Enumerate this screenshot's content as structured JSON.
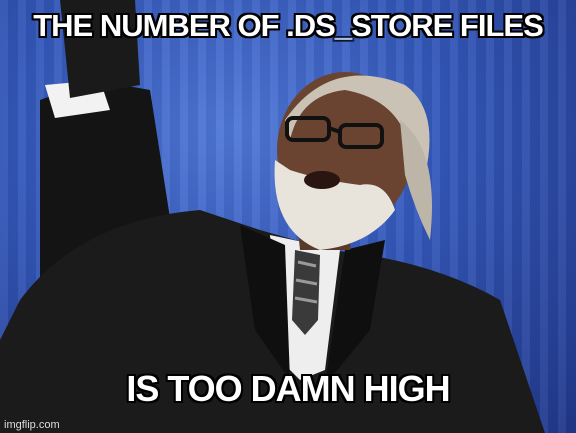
{
  "meme": {
    "top_text": "THE NUMBER OF .DS_STORE FILES",
    "bottom_text": "IS TOO DAMN HIGH",
    "watermark": "imgflip.com"
  }
}
